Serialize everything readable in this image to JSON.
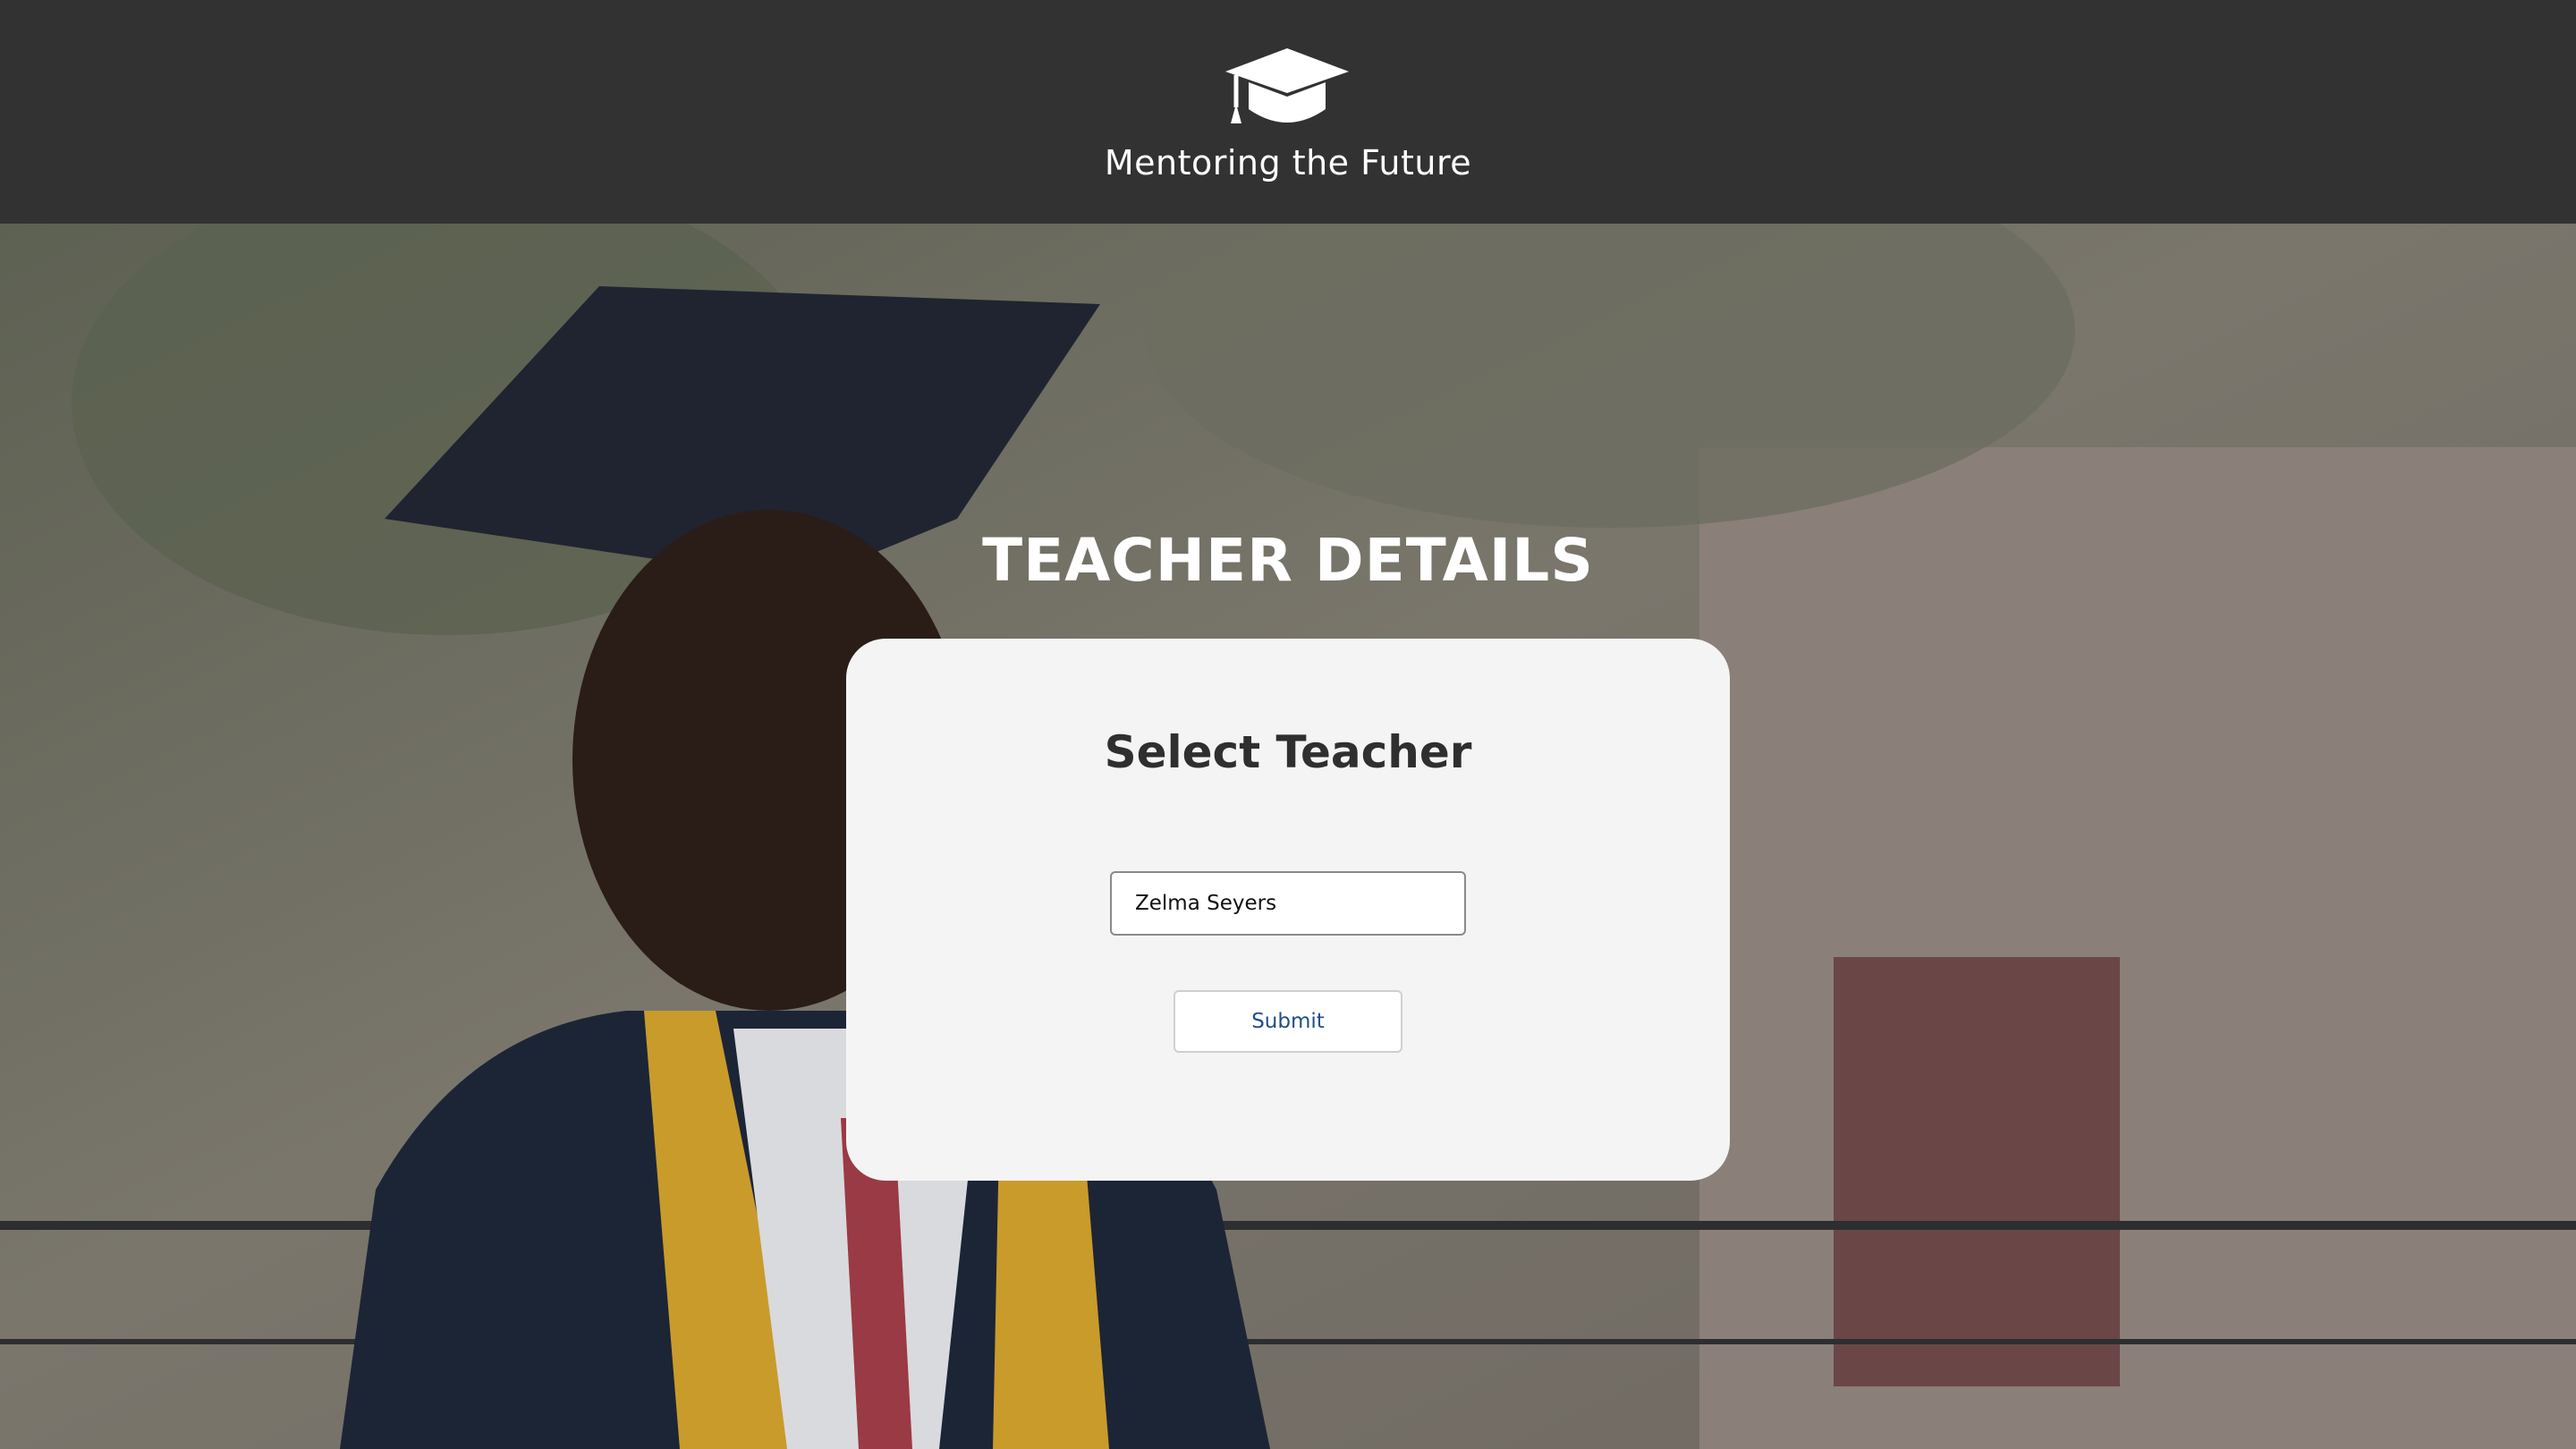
{
  "header": {
    "brand_name": "Mentoring the Future",
    "logo_icon": "graduation-cap-icon",
    "background_color": "#323232"
  },
  "main": {
    "page_title": "TEACHER DETAILS",
    "card": {
      "title": "Select Teacher",
      "teacher_select": {
        "value": "Zelma Seyers"
      },
      "submit_label": "Submit"
    }
  },
  "colors": {
    "card_background": "#f4f4f4",
    "submit_text": "#1f4f86",
    "title_text": "#ffffff"
  }
}
